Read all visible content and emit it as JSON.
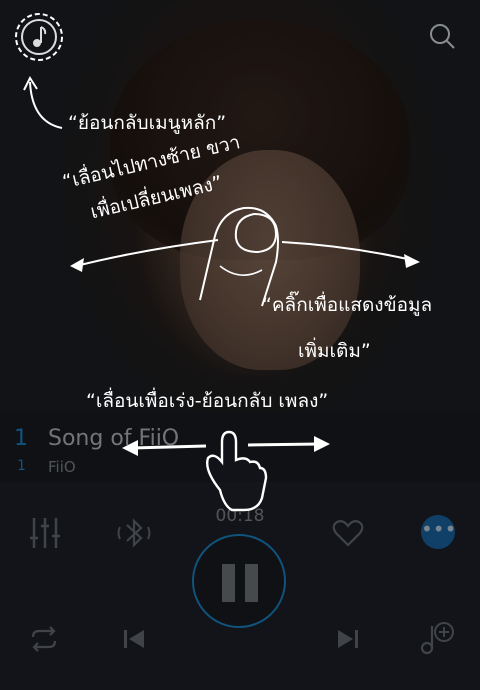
{
  "track": {
    "number": "1",
    "sub_number": "1",
    "title": "Song of FiiO",
    "artist": "FiiO",
    "elapsed": "00:18"
  },
  "hints": {
    "back_to_menu": "“ย้อนกลับเมนูหลัก”",
    "swipe_change_line1": "“เลื่อนไปทางซ้าย ขวา",
    "swipe_change_line2": "เพื่อเปลี่ยนเพลง”",
    "tap_info_line1": "“คลิ๊กเพื่อแสดงข้อมูล",
    "tap_info_line2": "เพิ่มเติม”",
    "seek": "“เลื่อนเพื่อเร่ง-ย้อนกลับ เพลง”"
  },
  "icons": {
    "menu": "music-note-icon",
    "search": "search-icon",
    "equalizer": "equalizer-icon",
    "bluetooth": "bluetooth-icon",
    "favorite": "heart-icon",
    "more": "more-icon",
    "repeat": "repeat-icon",
    "previous": "previous-icon",
    "play_pause": "pause-icon",
    "next": "next-icon",
    "add_to_playlist": "add-to-playlist-icon"
  },
  "colors": {
    "accent": "#1d8fd6",
    "overlay_text": "#ffffff"
  }
}
